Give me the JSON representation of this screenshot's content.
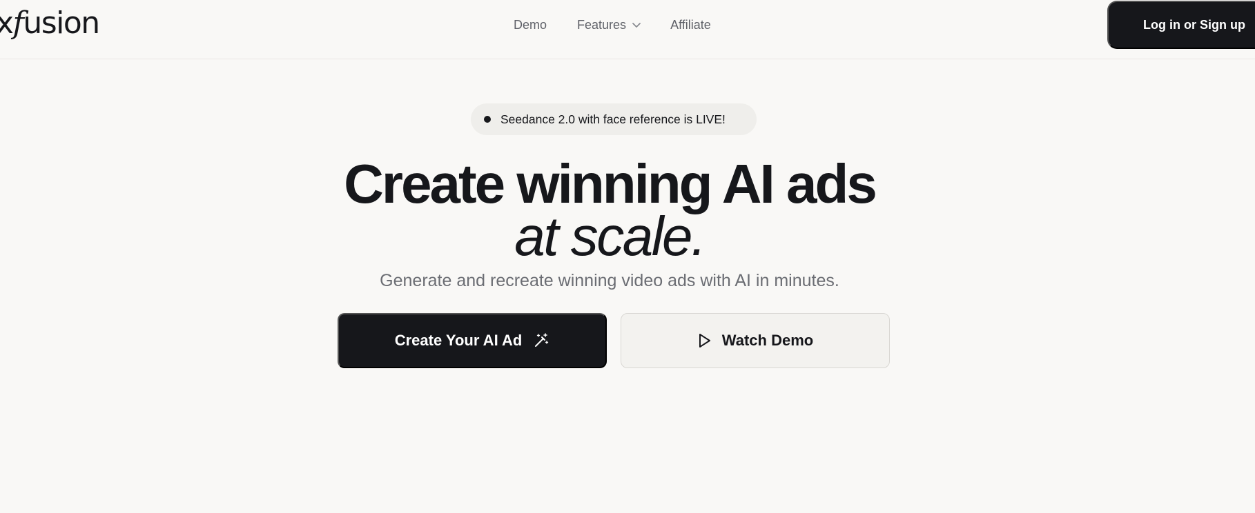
{
  "header": {
    "logo_prefix": "x",
    "logo_f": "f",
    "logo_suffix": "usion",
    "nav": {
      "demo": "Demo",
      "features": "Features",
      "affiliate": "Affiliate"
    },
    "login_label": "Log in or Sign up"
  },
  "announcement": {
    "text": "Seedance 2.0 with face reference is LIVE!"
  },
  "hero": {
    "title_line1": "Create winning AI ads",
    "title_line2": "at scale.",
    "subtitle": "Generate and recreate winning video ads with AI in minutes."
  },
  "actions": {
    "primary_label": "Create Your AI Ad",
    "primary_icon": "magic-wand-icon",
    "secondary_label": "Watch Demo",
    "secondary_icon": "play-icon"
  },
  "colors": {
    "background": "#f9f8f6",
    "primary": "#16171b",
    "muted_text": "#6b6d73",
    "pill_background": "#efeeeb"
  }
}
